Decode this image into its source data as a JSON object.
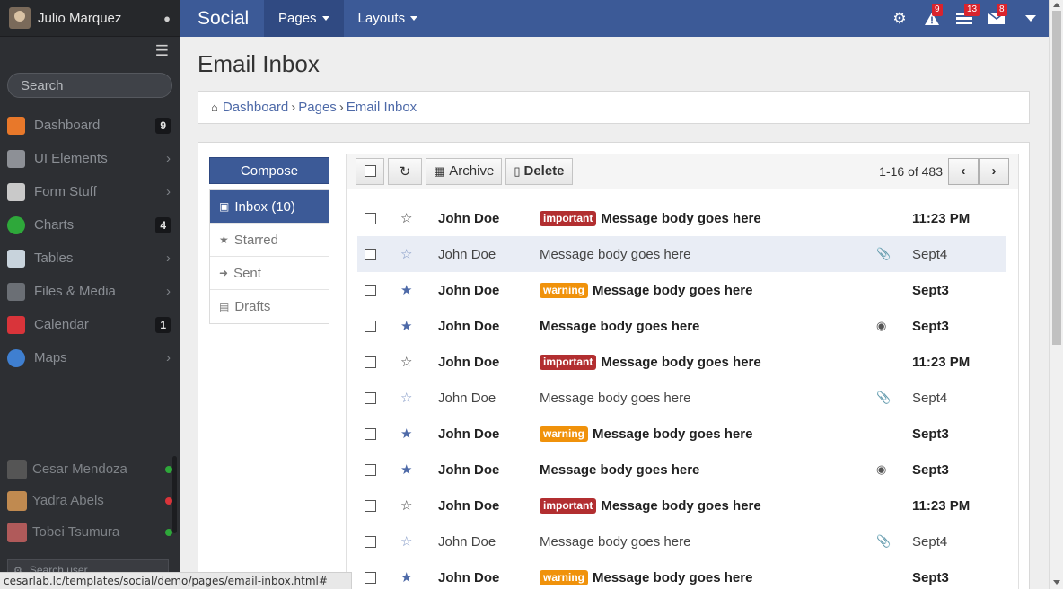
{
  "sidebar": {
    "user_name": "Julio Marquez",
    "search_placeholder": "Search",
    "items": [
      {
        "label": "Dashboard",
        "badge": "9",
        "icon": "home-icon",
        "color": "#e8782a"
      },
      {
        "label": "UI Elements",
        "chevron": "›",
        "icon": "server-icon",
        "color": "#8d9096"
      },
      {
        "label": "Form Stuff",
        "chevron": "›",
        "icon": "form-icon",
        "color": "#c9c9c9"
      },
      {
        "label": "Charts",
        "badge": "4",
        "icon": "pie-chart-icon",
        "color": "#2ea83a"
      },
      {
        "label": "Tables",
        "chevron": "›",
        "icon": "table-icon",
        "color": "#c8d3dc"
      },
      {
        "label": "Files & Media",
        "chevron": "›",
        "icon": "camera-icon",
        "color": "#6b6f75"
      },
      {
        "label": "Calendar",
        "badge": "1",
        "icon": "calendar-icon",
        "color": "#d9343a"
      },
      {
        "label": "Maps",
        "chevron": "›",
        "icon": "globe-icon",
        "color": "#3f7fd0"
      }
    ],
    "contacts": [
      {
        "name": "Cesar Mendoza",
        "status_color": "#2ea83a"
      },
      {
        "name": "Yadra Abels",
        "status_color": "#d9343a"
      },
      {
        "name": "Tobei Tsumura",
        "status_color": "#2ea83a"
      }
    ],
    "user_search_placeholder": "Search user..."
  },
  "topbar": {
    "brand": "Social",
    "nav": [
      "Pages",
      "Layouts"
    ],
    "badges": {
      "alerts": "9",
      "tasks": "13",
      "messages": "8"
    }
  },
  "page": {
    "title": "Email Inbox",
    "breadcrumb": [
      "Dashboard",
      "Pages",
      "Email Inbox"
    ]
  },
  "mail": {
    "compose": "Compose",
    "folders": [
      "Inbox (10)",
      "Starred",
      "Sent",
      "Drafts"
    ],
    "toolbar": {
      "archive": "Archive",
      "delete": "Delete",
      "pager": "1-16 of 483"
    },
    "rows": [
      {
        "from": "John Doe",
        "label": "important",
        "body": "Message body goes here",
        "time": "11:23 PM",
        "bold": true,
        "star": "outline",
        "att": ""
      },
      {
        "from": "John Doe",
        "label": "",
        "body": "Message body goes here",
        "time": "Sept4",
        "bold": false,
        "star": "outline-blue",
        "att": "paperclip"
      },
      {
        "from": "John Doe",
        "label": "warning",
        "body": "Message body goes here",
        "time": "Sept3",
        "bold": true,
        "star": "filled",
        "att": ""
      },
      {
        "from": "John Doe",
        "label": "",
        "body": "Message body goes here",
        "time": "Sept3",
        "bold": true,
        "star": "filled",
        "att": "comments"
      },
      {
        "from": "John Doe",
        "label": "important",
        "body": "Message body goes here",
        "time": "11:23 PM",
        "bold": true,
        "star": "outline",
        "att": ""
      },
      {
        "from": "John Doe",
        "label": "",
        "body": "Message body goes here",
        "time": "Sept4",
        "bold": false,
        "star": "outline-blue",
        "att": "paperclip"
      },
      {
        "from": "John Doe",
        "label": "warning",
        "body": "Message body goes here",
        "time": "Sept3",
        "bold": true,
        "star": "filled",
        "att": ""
      },
      {
        "from": "John Doe",
        "label": "",
        "body": "Message body goes here",
        "time": "Sept3",
        "bold": true,
        "star": "filled",
        "att": "comments"
      },
      {
        "from": "John Doe",
        "label": "important",
        "body": "Message body goes here",
        "time": "11:23 PM",
        "bold": true,
        "star": "outline",
        "att": ""
      },
      {
        "from": "John Doe",
        "label": "",
        "body": "Message body goes here",
        "time": "Sept4",
        "bold": false,
        "star": "outline-blue",
        "att": "paperclip"
      },
      {
        "from": "John Doe",
        "label": "warning",
        "body": "Message body goes here",
        "time": "Sept3",
        "bold": true,
        "star": "filled",
        "att": ""
      }
    ]
  },
  "status_url": "cesarlab.lc/templates/social/demo/pages/email-inbox.html#"
}
